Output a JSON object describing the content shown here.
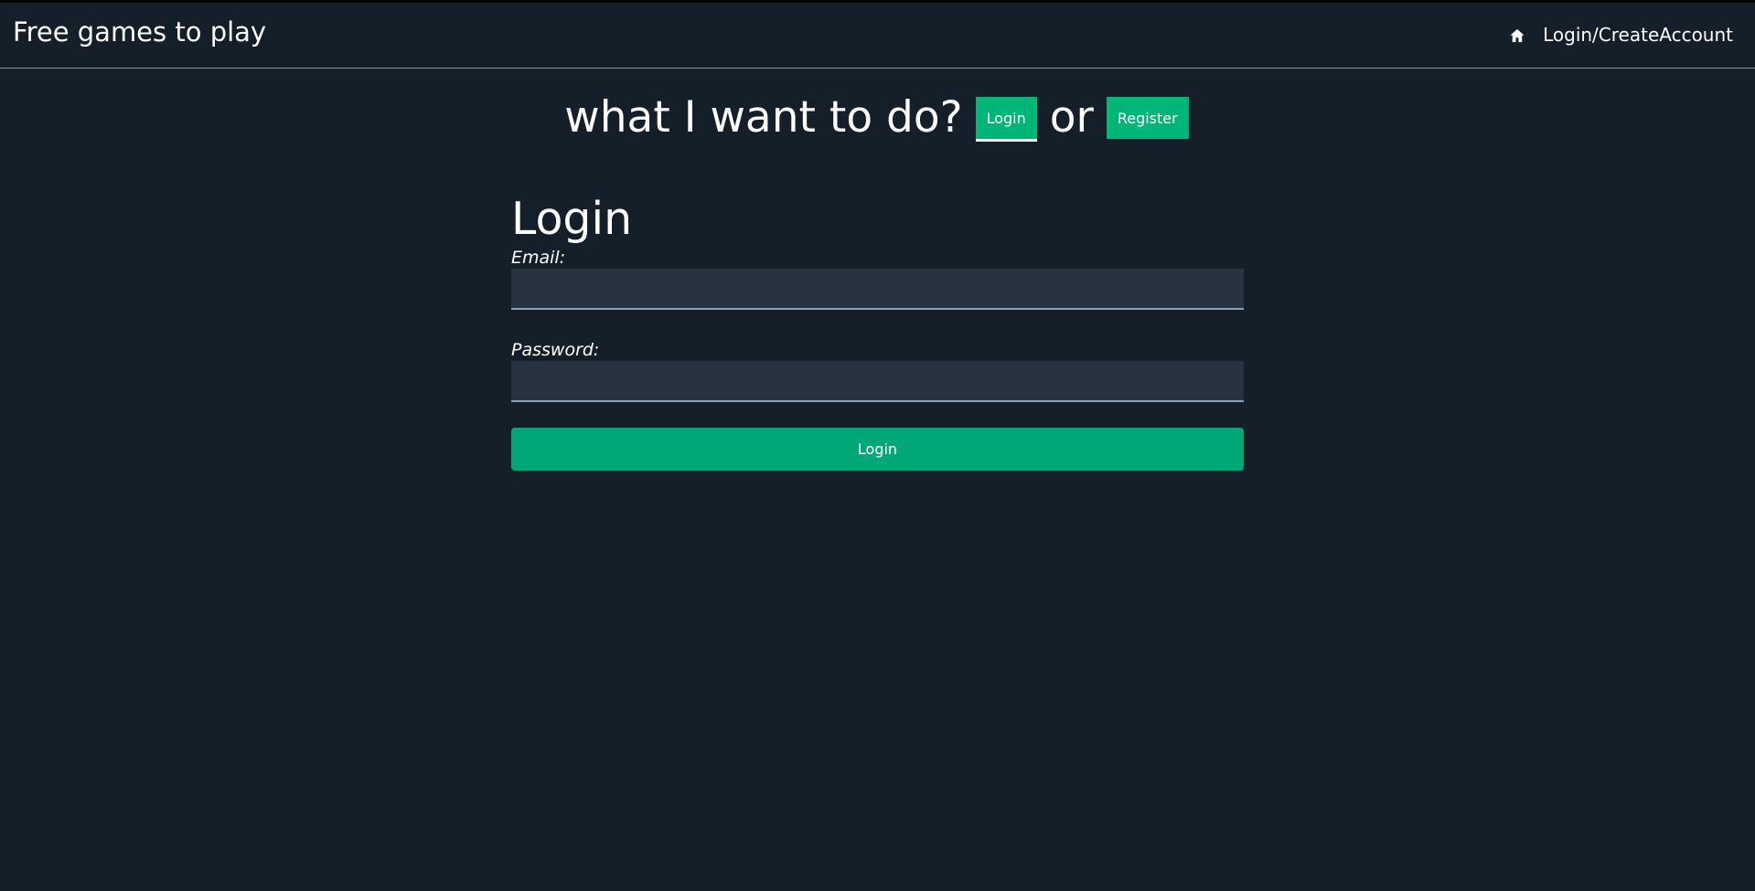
{
  "navbar": {
    "brand": "Free games to play",
    "home_icon": "home-icon",
    "login_link": "Login/CreateAccount"
  },
  "choice": {
    "prompt": "what I want to do?",
    "login_label": "Login",
    "or_text": "or",
    "register_label": "Register"
  },
  "form": {
    "title": "Login",
    "email_label": "Email:",
    "email_value": "",
    "password_label": "Password:",
    "password_value": "",
    "submit_label": "Login"
  },
  "colors": {
    "background": "#151f2a",
    "accent": "#00b578",
    "input_bg": "#273341"
  }
}
